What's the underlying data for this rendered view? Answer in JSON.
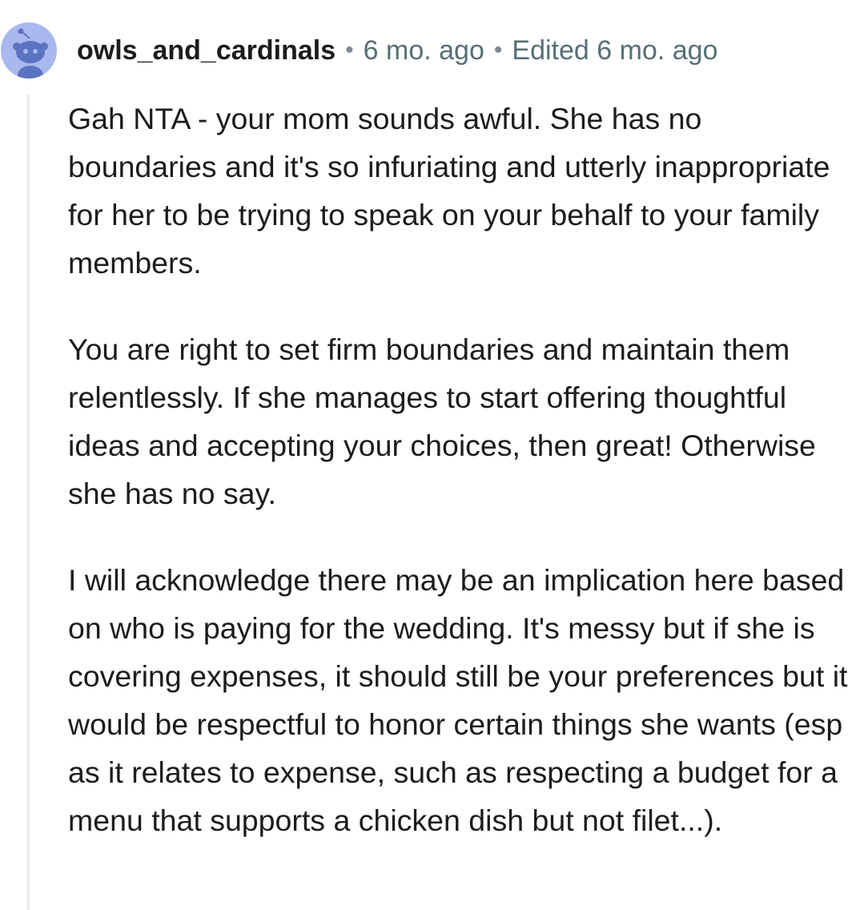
{
  "comment": {
    "username": "owls_and_cardinals",
    "separator": "•",
    "time": "6 mo. ago",
    "edited": "Edited 6 mo. ago",
    "paragraphs": [
      "Gah NTA - your mom sounds awful. She has no boundaries and it's so infuriating and utterly inappropriate for her to be trying to speak on your behalf to your family members.",
      "You are right to set firm boundaries and maintain them relentlessly. If she manages to start offering thoughtful ideas and accepting your choices, then great! Otherwise she has no say.",
      "I will acknowledge there may be an implication here based on who is paying for the wedding. It's messy but if she is covering expenses, it should still be your preferences but it would be respectful to honor certain things she wants (esp as it relates to expense, such as respecting a budget for a menu that supports a chicken dish but not filet...)."
    ]
  },
  "avatar": {
    "icon": "snoo-avatar-icon",
    "background_color": "#a9b8ee",
    "figure_color": "#5b74c2"
  },
  "colors": {
    "username": "#1c1c1c",
    "meta": "#576f76",
    "body": "#1c1c1c",
    "thread_line": "#e5ebee"
  }
}
